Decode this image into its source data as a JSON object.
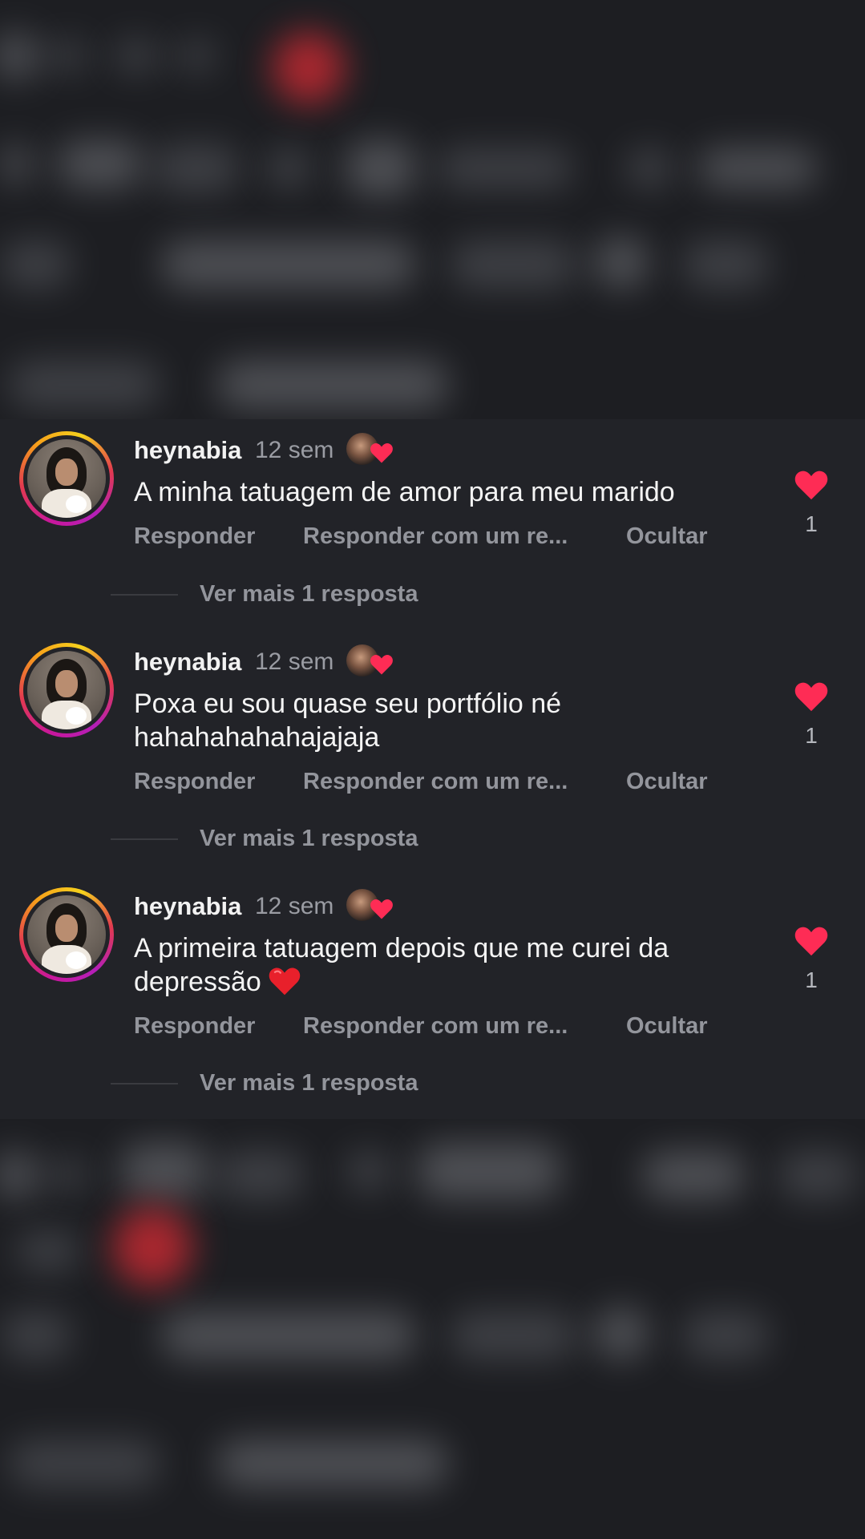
{
  "comments": [
    {
      "username": "heynabia",
      "time": "12 sem",
      "text": "A minha tatuagem de amor para meu marido",
      "text_emoji": "",
      "actions": {
        "reply": "Responder",
        "reply_with": "Responder com um re...",
        "hide": "Ocultar"
      },
      "like_count": "1",
      "more_replies": "Ver mais 1 resposta"
    },
    {
      "username": "heynabia",
      "time": "12 sem",
      "text": "Poxa eu sou quase seu portfólio né hahahahahahajajaja",
      "text_emoji": "",
      "actions": {
        "reply": "Responder",
        "reply_with": "Responder com um re...",
        "hide": "Ocultar"
      },
      "like_count": "1",
      "more_replies": "Ver mais 1 resposta"
    },
    {
      "username": "heynabia",
      "time": "12 sem",
      "text": "A primeira tatuagem depois que me curei da depressão",
      "text_emoji": "red-heart-emoji",
      "actions": {
        "reply": "Responder",
        "reply_with": "Responder com um re...",
        "hide": "Ocultar"
      },
      "like_count": "1",
      "more_replies": "Ver mais 1 resposta"
    }
  ],
  "icons": {
    "like": "heart-icon",
    "author_liked": "author-avatar-with-heart",
    "emoji": "red-heart-emoji"
  },
  "colors": {
    "background": "#222328",
    "like_red": "#fe2c55",
    "secondary_text": "#93959c",
    "primary_text": "#f4f4f4"
  }
}
